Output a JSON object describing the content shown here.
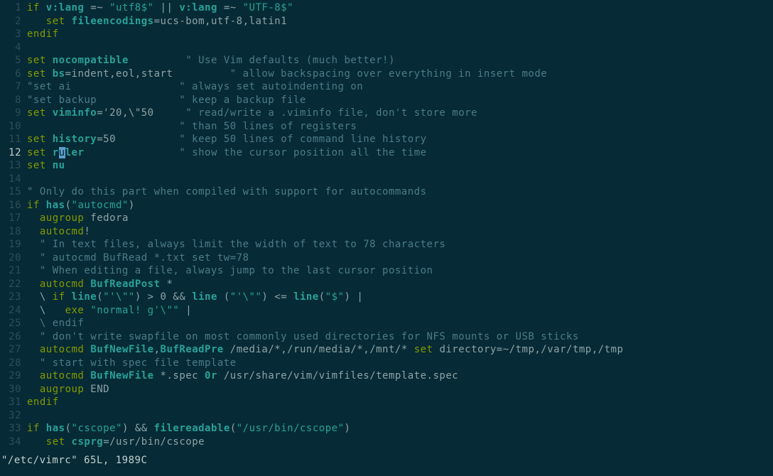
{
  "file_path": "\"/etc/vimrc\"",
  "status_info": " 65L, 1989C",
  "cursor_line": 12,
  "lines": [
    {
      "n": 1,
      "tokens": [
        {
          "c": "kw",
          "t": "if"
        },
        {
          "t": " "
        },
        {
          "c": "id",
          "t": "v:lang"
        },
        {
          "t": " =~ "
        },
        {
          "c": "str",
          "t": "\"utf8$\""
        },
        {
          "t": " || "
        },
        {
          "c": "id",
          "t": "v:lang"
        },
        {
          "t": " =~ "
        },
        {
          "c": "str",
          "t": "\"UTF-8$\""
        }
      ]
    },
    {
      "n": 2,
      "tokens": [
        {
          "t": "   "
        },
        {
          "c": "kw",
          "t": "set"
        },
        {
          "t": " "
        },
        {
          "c": "id",
          "t": "fileencodings"
        },
        {
          "t": "=ucs-bom,utf-8,latin1"
        }
      ]
    },
    {
      "n": 3,
      "tokens": [
        {
          "c": "kw",
          "t": "endif"
        }
      ]
    },
    {
      "n": 4,
      "tokens": []
    },
    {
      "n": 5,
      "tokens": [
        {
          "c": "kw",
          "t": "set"
        },
        {
          "t": " "
        },
        {
          "c": "id",
          "t": "nocompatible"
        },
        {
          "t": "         "
        },
        {
          "c": "cmt",
          "t": "\" Use Vim defaults (much better!)"
        }
      ]
    },
    {
      "n": 6,
      "tokens": [
        {
          "c": "kw",
          "t": "set"
        },
        {
          "t": " "
        },
        {
          "c": "id",
          "t": "bs"
        },
        {
          "t": "=indent,eol,start         "
        },
        {
          "c": "cmt",
          "t": "\" allow backspacing over everything in insert mode"
        }
      ]
    },
    {
      "n": 7,
      "tokens": [
        {
          "c": "cmt",
          "t": "\"set ai                 \" always set autoindenting on"
        }
      ]
    },
    {
      "n": 8,
      "tokens": [
        {
          "c": "cmt",
          "t": "\"set backup             \" keep a backup file"
        }
      ]
    },
    {
      "n": 9,
      "tokens": [
        {
          "c": "kw",
          "t": "set"
        },
        {
          "t": " "
        },
        {
          "c": "id",
          "t": "viminfo"
        },
        {
          "t": "='20,\\\"50     "
        },
        {
          "c": "cmt",
          "t": "\" read/write a .viminfo file, don't store more"
        }
      ]
    },
    {
      "n": 10,
      "tokens": [
        {
          "t": "                        "
        },
        {
          "c": "cmt",
          "t": "\" than 50 lines of registers"
        }
      ]
    },
    {
      "n": 11,
      "tokens": [
        {
          "c": "kw",
          "t": "set"
        },
        {
          "t": " "
        },
        {
          "c": "id",
          "t": "history"
        },
        {
          "t": "=50          "
        },
        {
          "c": "cmt",
          "t": "\" keep 50 lines of command line history"
        }
      ]
    },
    {
      "n": 12,
      "tokens": [
        {
          "c": "kw",
          "t": "set"
        },
        {
          "t": " "
        },
        {
          "c": "id",
          "t": "r"
        },
        {
          "c": "cursor",
          "t": "u"
        },
        {
          "c": "id",
          "t": "ler"
        },
        {
          "t": "               "
        },
        {
          "c": "cmt",
          "t": "\" show the cursor position all the time"
        }
      ]
    },
    {
      "n": 13,
      "tokens": [
        {
          "c": "kw",
          "t": "set"
        },
        {
          "t": " "
        },
        {
          "c": "id",
          "t": "nu"
        }
      ]
    },
    {
      "n": 14,
      "tokens": []
    },
    {
      "n": 15,
      "tokens": [
        {
          "c": "cmt",
          "t": "\" Only do this part when compiled with support for autocommands"
        }
      ]
    },
    {
      "n": 16,
      "tokens": [
        {
          "c": "kw",
          "t": "if"
        },
        {
          "t": " "
        },
        {
          "c": "id",
          "t": "has"
        },
        {
          "t": "("
        },
        {
          "c": "str",
          "t": "\"autocmd\""
        },
        {
          "t": ")"
        }
      ]
    },
    {
      "n": 17,
      "tokens": [
        {
          "t": "  "
        },
        {
          "c": "kw",
          "t": "augroup"
        },
        {
          "t": " fedora"
        }
      ]
    },
    {
      "n": 18,
      "tokens": [
        {
          "t": "  "
        },
        {
          "c": "kw",
          "t": "autocmd"
        },
        {
          "t": "!"
        }
      ]
    },
    {
      "n": 19,
      "tokens": [
        {
          "t": "  "
        },
        {
          "c": "cmt",
          "t": "\" In text files, always limit the width of text to 78 characters"
        }
      ]
    },
    {
      "n": 20,
      "tokens": [
        {
          "t": "  "
        },
        {
          "c": "cmt",
          "t": "\" autocmd BufRead *.txt set tw=78"
        }
      ]
    },
    {
      "n": 21,
      "tokens": [
        {
          "t": "  "
        },
        {
          "c": "cmt",
          "t": "\" When editing a file, always jump to the last cursor position"
        }
      ]
    },
    {
      "n": 22,
      "tokens": [
        {
          "t": "  "
        },
        {
          "c": "kw",
          "t": "autocmd"
        },
        {
          "t": " "
        },
        {
          "c": "id",
          "t": "BufReadPost"
        },
        {
          "t": " *"
        }
      ]
    },
    {
      "n": 23,
      "tokens": [
        {
          "t": "  \\ "
        },
        {
          "c": "kw",
          "t": "if"
        },
        {
          "t": " "
        },
        {
          "c": "id",
          "t": "line"
        },
        {
          "t": "("
        },
        {
          "c": "str",
          "t": "\"'\\\"\""
        },
        {
          "t": ") > 0 && "
        },
        {
          "c": "id",
          "t": "line"
        },
        {
          "t": " ("
        },
        {
          "c": "str",
          "t": "\"'\\\"\""
        },
        {
          "t": ") <= "
        },
        {
          "c": "id",
          "t": "line"
        },
        {
          "t": "("
        },
        {
          "c": "str",
          "t": "\"$\""
        },
        {
          "t": ") |"
        }
      ]
    },
    {
      "n": 24,
      "tokens": [
        {
          "t": "  \\   "
        },
        {
          "c": "kw",
          "t": "exe"
        },
        {
          "t": " "
        },
        {
          "c": "str",
          "t": "\"normal! g'\\\"\""
        },
        {
          "t": " |"
        }
      ]
    },
    {
      "n": 25,
      "tokens": [
        {
          "t": "  "
        },
        {
          "c": "cmt",
          "t": "\\ endif"
        }
      ]
    },
    {
      "n": 26,
      "tokens": [
        {
          "t": "  "
        },
        {
          "c": "cmt",
          "t": "\" don't write swapfile on most commonly used directories for NFS mounts or USB sticks"
        }
      ]
    },
    {
      "n": 27,
      "tokens": [
        {
          "t": "  "
        },
        {
          "c": "kw",
          "t": "autocmd"
        },
        {
          "t": " "
        },
        {
          "c": "id",
          "t": "BufNewFile"
        },
        {
          "t": ","
        },
        {
          "c": "id",
          "t": "BufReadPre"
        },
        {
          "t": " /media/*,/run/media/*,/mnt/* "
        },
        {
          "c": "kw",
          "t": "set"
        },
        {
          "t": " directory=~/tmp,/var/tmp,/tmp"
        }
      ]
    },
    {
      "n": 28,
      "tokens": [
        {
          "t": "  "
        },
        {
          "c": "cmt",
          "t": "\" start with spec file template"
        }
      ]
    },
    {
      "n": 29,
      "tokens": [
        {
          "t": "  "
        },
        {
          "c": "kw",
          "t": "autocmd"
        },
        {
          "t": " "
        },
        {
          "c": "id",
          "t": "BufNewFile"
        },
        {
          "t": " *.spec "
        },
        {
          "c": "id",
          "t": "0r"
        },
        {
          "t": " /usr/share/vim/vimfiles/template.spec"
        }
      ]
    },
    {
      "n": 30,
      "tokens": [
        {
          "t": "  "
        },
        {
          "c": "kw",
          "t": "augroup"
        },
        {
          "t": " END"
        }
      ]
    },
    {
      "n": 31,
      "tokens": [
        {
          "c": "kw",
          "t": "endif"
        }
      ]
    },
    {
      "n": 32,
      "tokens": []
    },
    {
      "n": 33,
      "tokens": [
        {
          "c": "kw",
          "t": "if"
        },
        {
          "t": " "
        },
        {
          "c": "id",
          "t": "has"
        },
        {
          "t": "("
        },
        {
          "c": "str",
          "t": "\"cscope\""
        },
        {
          "t": ") && "
        },
        {
          "c": "id",
          "t": "filereadable"
        },
        {
          "t": "("
        },
        {
          "c": "str",
          "t": "\"/usr/bin/cscope\""
        },
        {
          "t": ")"
        }
      ]
    },
    {
      "n": 34,
      "tokens": [
        {
          "t": "   "
        },
        {
          "c": "kw",
          "t": "set"
        },
        {
          "t": " "
        },
        {
          "c": "id",
          "t": "csprg"
        },
        {
          "t": "=/usr/bin/cscope"
        }
      ]
    }
  ]
}
